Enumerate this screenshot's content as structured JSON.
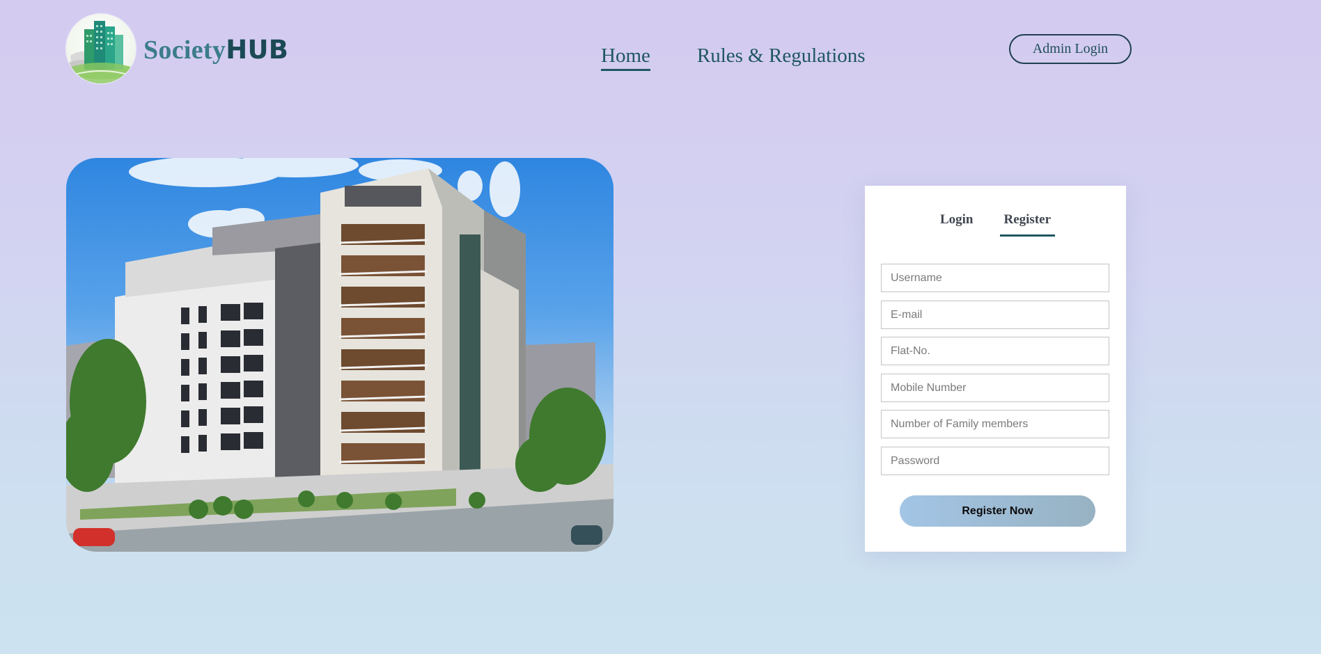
{
  "brand": {
    "name_part1": "Society",
    "name_part2": "HUB"
  },
  "nav": {
    "items": [
      {
        "label": "Home",
        "active": true
      },
      {
        "label": "Rules & Regulations",
        "active": false
      }
    ]
  },
  "admin": {
    "label": "Admin Login"
  },
  "form": {
    "tabs": [
      {
        "label": "Login",
        "active": false
      },
      {
        "label": "Register",
        "active": true
      }
    ],
    "fields": [
      {
        "placeholder": "Username",
        "value": ""
      },
      {
        "placeholder": "E-mail",
        "value": ""
      },
      {
        "placeholder": "Flat-No.",
        "value": ""
      },
      {
        "placeholder": "Mobile Number",
        "value": ""
      },
      {
        "placeholder": "Number of Family members",
        "value": ""
      },
      {
        "placeholder": "Password",
        "value": ""
      }
    ],
    "submit_label": "Register Now"
  },
  "colors": {
    "accent": "#1f5662",
    "brand_light": "#3c7c8a",
    "brand_dark": "#1b4a55"
  },
  "icons": {
    "logo": "building-logo-icon",
    "hero": "apartment-building-image"
  }
}
